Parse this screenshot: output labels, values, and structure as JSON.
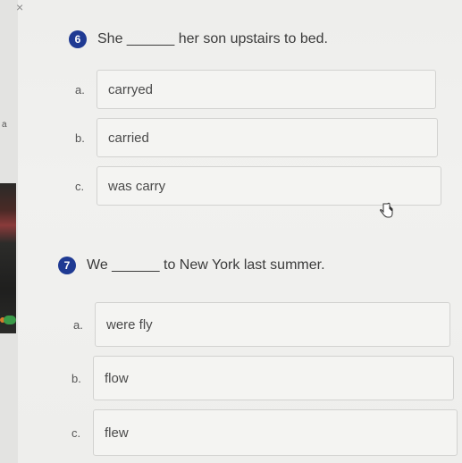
{
  "accent_color": "#1f3a93",
  "corner_mark": "×",
  "side_mark": "a",
  "questions": [
    {
      "number": "6",
      "prompt": "She ______ her son upstairs to bed.",
      "options": [
        {
          "letter": "a.",
          "text": "carryed"
        },
        {
          "letter": "b.",
          "text": "carried"
        },
        {
          "letter": "c.",
          "text": "was carry"
        }
      ]
    },
    {
      "number": "7",
      "prompt": "We ______ to New York last summer.",
      "options": [
        {
          "letter": "a.",
          "text": "were fly"
        },
        {
          "letter": "b.",
          "text": "flow"
        },
        {
          "letter": "c.",
          "text": "flew"
        }
      ]
    }
  ]
}
